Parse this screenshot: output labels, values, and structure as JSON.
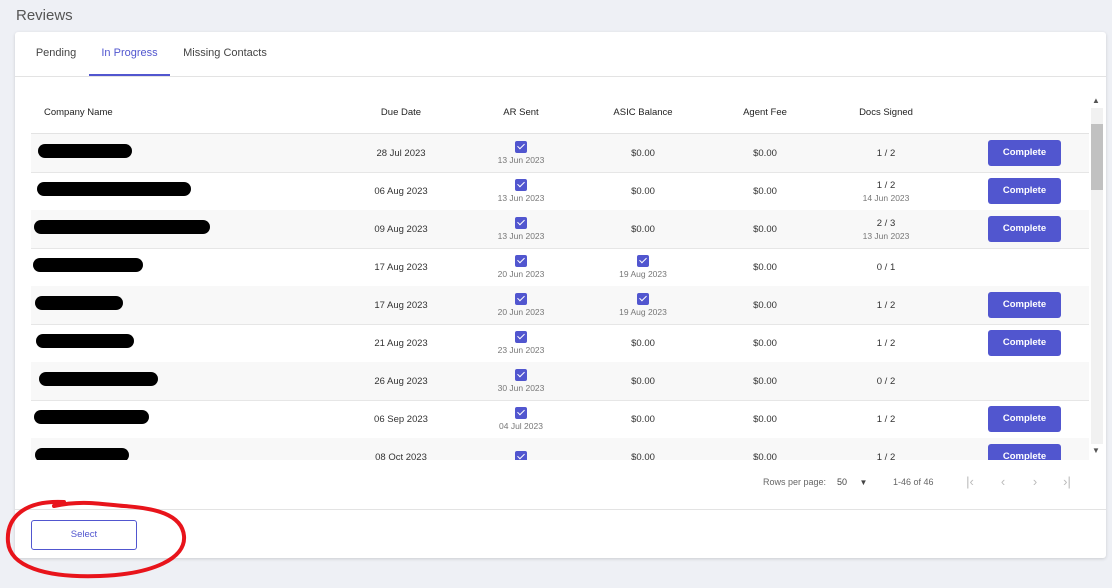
{
  "page": {
    "title": "Reviews"
  },
  "tabs": [
    {
      "label": "Pending",
      "active": false
    },
    {
      "label": "In Progress",
      "active": true
    },
    {
      "label": "Missing Contacts",
      "active": false
    }
  ],
  "table": {
    "headers": {
      "company": "Company Name",
      "due": "Due Date",
      "ar": "AR Sent",
      "asic": "ASIC Balance",
      "agent": "Agent Fee",
      "docs": "Docs Signed"
    },
    "complete_label": "Complete",
    "rows": [
      {
        "due": "28 Jul 2023",
        "ar_checked": true,
        "ar_date": "13 Jun 2023",
        "asic": "$0.00",
        "asic_checked": false,
        "asic_date": "",
        "agent": "$0.00",
        "docs": "1 / 2",
        "docs_date": "",
        "complete": true
      },
      {
        "due": "06 Aug 2023",
        "ar_checked": true,
        "ar_date": "13 Jun 2023",
        "asic": "$0.00",
        "asic_checked": false,
        "asic_date": "",
        "agent": "$0.00",
        "docs": "1 / 2",
        "docs_date": "14 Jun 2023",
        "complete": true
      },
      {
        "due": "09 Aug 2023",
        "ar_checked": true,
        "ar_date": "13 Jun 2023",
        "asic": "$0.00",
        "asic_checked": false,
        "asic_date": "",
        "agent": "$0.00",
        "docs": "2 / 3",
        "docs_date": "13 Jun 2023",
        "complete": true
      },
      {
        "due": "17 Aug 2023",
        "ar_checked": true,
        "ar_date": "20 Jun 2023",
        "asic": "",
        "asic_checked": true,
        "asic_date": "19 Aug 2023",
        "agent": "$0.00",
        "docs": "0 / 1",
        "docs_date": "",
        "complete": false
      },
      {
        "due": "17 Aug 2023",
        "ar_checked": true,
        "ar_date": "20 Jun 2023",
        "asic": "",
        "asic_checked": true,
        "asic_date": "19 Aug 2023",
        "agent": "$0.00",
        "docs": "1 / 2",
        "docs_date": "",
        "complete": true
      },
      {
        "due": "21 Aug 2023",
        "ar_checked": true,
        "ar_date": "23 Jun 2023",
        "asic": "$0.00",
        "asic_checked": false,
        "asic_date": "",
        "agent": "$0.00",
        "docs": "1 / 2",
        "docs_date": "",
        "complete": true
      },
      {
        "due": "26 Aug 2023",
        "ar_checked": true,
        "ar_date": "30 Jun 2023",
        "asic": "$0.00",
        "asic_checked": false,
        "asic_date": "",
        "agent": "$0.00",
        "docs": "0 / 2",
        "docs_date": "",
        "complete": false
      },
      {
        "due": "06 Sep 2023",
        "ar_checked": true,
        "ar_date": "04 Jul 2023",
        "asic": "$0.00",
        "asic_checked": false,
        "asic_date": "",
        "agent": "$0.00",
        "docs": "1 / 2",
        "docs_date": "",
        "complete": true
      },
      {
        "due": "08 Oct 2023",
        "ar_checked": true,
        "ar_date": "",
        "asic": "$0.00",
        "asic_checked": false,
        "asic_date": "",
        "agent": "$0.00",
        "docs": "1 / 2",
        "docs_date": "",
        "complete": true
      }
    ]
  },
  "pagination": {
    "rows_per_page_label": "Rows per page:",
    "rows_per_page_value": "50",
    "range": "1-46 of 46"
  },
  "footer": {
    "select_label": "Select"
  },
  "colors": {
    "accent": "#5156cf",
    "annotation": "#e8141b"
  }
}
